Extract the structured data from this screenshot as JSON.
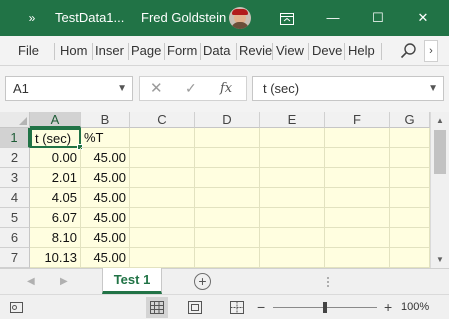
{
  "titlebar": {
    "qa_more": "»",
    "title": "TestData1...",
    "user_name": "Fred Goldstein",
    "min_glyph": "—",
    "max_glyph": "☐",
    "close_glyph": "✕"
  },
  "ribbon": {
    "tabs": [
      "File",
      "Hom",
      "Inser",
      "Page",
      "Form",
      "Data",
      "Revie",
      "View",
      "Deve",
      "Help"
    ],
    "scroll_glyph": "›"
  },
  "formula_bar": {
    "name_box": "A1",
    "cancel_glyph": "✕",
    "enter_glyph": "✓",
    "fx_label": "fx",
    "content": "t (sec)"
  },
  "sheet": {
    "columns": [
      "A",
      "B",
      "C",
      "D",
      "E",
      "F",
      "G"
    ],
    "rows": [
      "1",
      "2",
      "3",
      "4",
      "5",
      "6",
      "7"
    ],
    "selected_cell": "A1",
    "cells": [
      [
        "t (sec)",
        "%T"
      ],
      [
        "0.00",
        "45.00"
      ],
      [
        "2.01",
        "45.00"
      ],
      [
        "4.05",
        "45.00"
      ],
      [
        "6.07",
        "45.00"
      ],
      [
        "8.10",
        "45.00"
      ],
      [
        "10.13",
        "45.00"
      ]
    ],
    "background_color": "#fffee0"
  },
  "sheet_tabs": {
    "nav_prev": "◀",
    "nav_next": "▶",
    "tabs": [
      "Test 1"
    ],
    "add_glyph": "+"
  },
  "status_bar": {
    "zoom_out": "−",
    "zoom_in": "+",
    "zoom": "100%"
  },
  "colors": {
    "accent": "#217346",
    "cell_fill": "#fffee0"
  }
}
